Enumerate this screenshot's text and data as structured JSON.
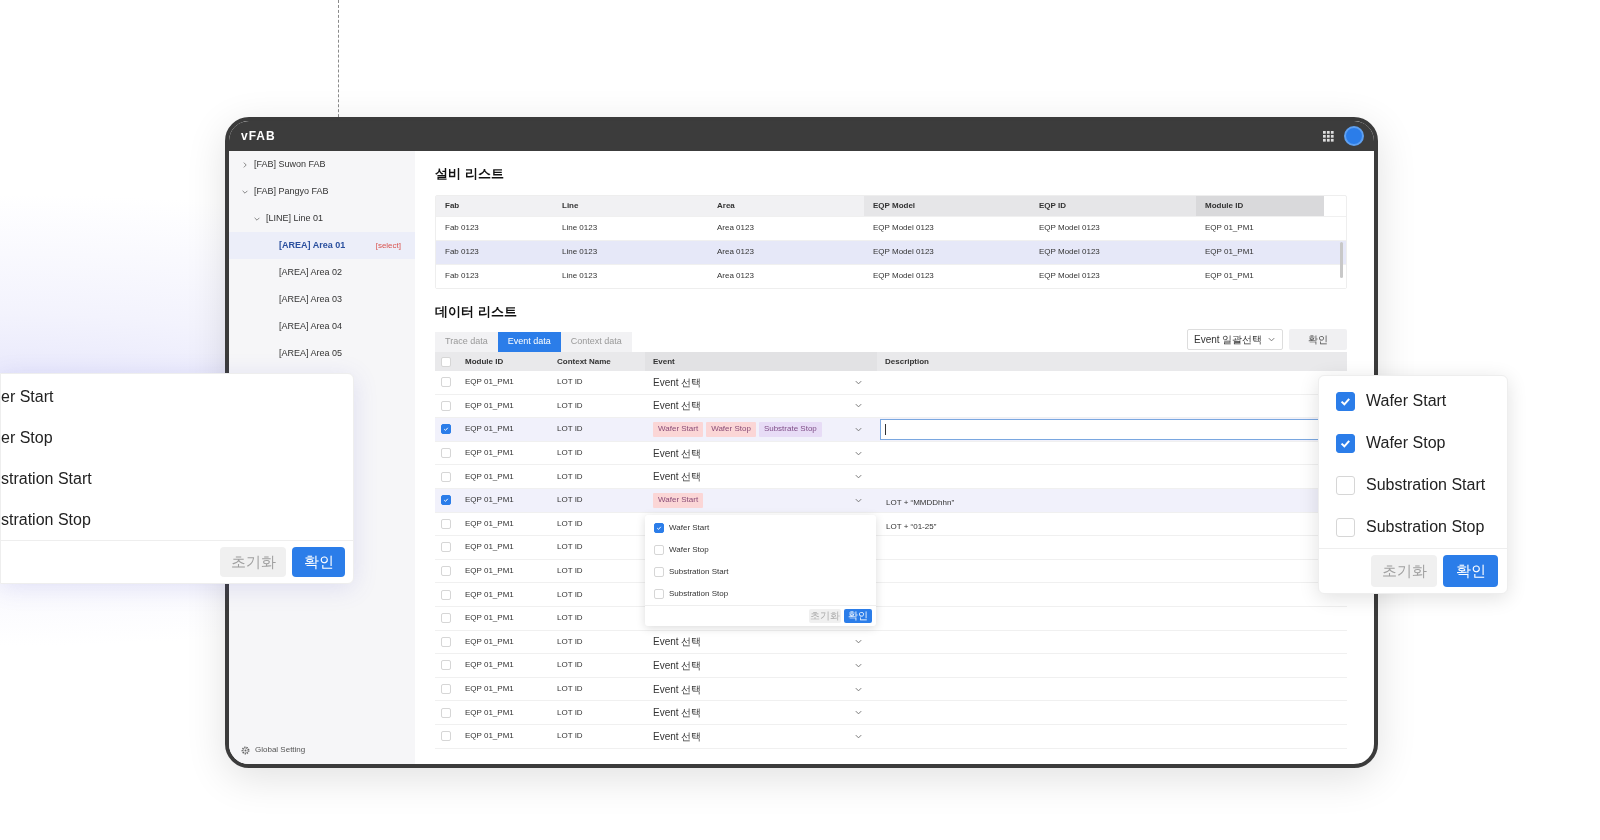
{
  "app": {
    "logo": "vFAB"
  },
  "sidebar": {
    "tree": [
      {
        "label": "[FAB] Suwon FAB",
        "expanded": false,
        "selected": false
      },
      {
        "label": "[FAB] Pangyo FAB",
        "expanded": true,
        "selected": false,
        "children": [
          {
            "label": "[LINE] Line 01",
            "expanded": true,
            "selected": false,
            "children": [
              {
                "label": "[AREA] Area 01",
                "selected": true,
                "badge": "[select]"
              },
              {
                "label": "[AREA] Area 02",
                "selected": false
              },
              {
                "label": "[AREA] Area 03",
                "selected": false
              },
              {
                "label": "[AREA] Area 04",
                "selected": false
              },
              {
                "label": "[AREA] Area 05",
                "selected": false
              }
            ]
          }
        ]
      }
    ],
    "footer": "Global Setting"
  },
  "equipment": {
    "title": "설비 리스트",
    "columns": [
      "Fab",
      "Line",
      "Area",
      "EQP Model",
      "EQP ID",
      "Module ID"
    ],
    "rows": [
      {
        "selected": false,
        "cells": [
          "Fab 0123",
          "Line 0123",
          "Area 0123",
          "EQP Model 0123",
          "EQP Model 0123",
          "EQP 01_PM1"
        ]
      },
      {
        "selected": true,
        "cells": [
          "Fab 0123",
          "Line 0123",
          "Area 0123",
          "EQP Model 0123",
          "EQP Model 0123",
          "EQP 01_PM1"
        ]
      },
      {
        "selected": false,
        "cells": [
          "Fab 0123",
          "Line 0123",
          "Area 0123",
          "EQP Model 0123",
          "EQP Model 0123",
          "EQP 01_PM1"
        ]
      }
    ]
  },
  "data": {
    "title": "데이터 리스트",
    "tabs": [
      {
        "label": "Trace data",
        "selected": false
      },
      {
        "label": "Event data",
        "selected": true
      },
      {
        "label": "Context data",
        "selected": false
      }
    ],
    "bulk_select": "Event 일괄선택",
    "confirm": "확인",
    "header_checked": false,
    "columns": [
      "Module ID",
      "Context Name",
      "Event",
      "Description"
    ],
    "rows": [
      {
        "checked": false,
        "module": "EQP 01_PM1",
        "context": "LOT ID",
        "event": "Event 선택"
      },
      {
        "checked": false,
        "module": "EQP 01_PM1",
        "context": "LOT ID",
        "event": "Event 선택"
      },
      {
        "checked": true,
        "module": "EQP 01_PM1",
        "context": "LOT ID",
        "tags": [
          {
            "label": "Wafer Start",
            "color": "#fbd6d6"
          },
          {
            "label": "Wafer Stop",
            "color": "#fbd6d6"
          },
          {
            "label": "Substrate Stop",
            "color": "#e7dcf6"
          }
        ],
        "editing": true
      },
      {
        "checked": false,
        "module": "EQP 01_PM1",
        "context": "LOT ID",
        "event": "Event 선택"
      },
      {
        "checked": false,
        "module": "EQP 01_PM1",
        "context": "LOT ID",
        "event": "Event 선택"
      },
      {
        "checked": true,
        "module": "EQP 01_PM1",
        "context": "LOT ID",
        "tags": [
          {
            "label": "Wafer Start",
            "color": "#fbd6d6"
          }
        ],
        "description": "LOT + “MMDDhhn”"
      },
      {
        "checked": false,
        "module": "EQP 01_PM1",
        "context": "LOT ID",
        "description": "LOT + “01-25”"
      },
      {
        "checked": false,
        "module": "EQP 01_PM1",
        "context": "LOT ID"
      },
      {
        "checked": false,
        "module": "EQP 01_PM1",
        "context": "LOT ID"
      },
      {
        "checked": false,
        "module": "EQP 01_PM1",
        "context": "LOT ID"
      },
      {
        "checked": false,
        "module": "EQP 01_PM1",
        "context": "LOT ID"
      },
      {
        "checked": false,
        "module": "EQP 01_PM1",
        "context": "LOT ID",
        "event": "Event 선택"
      },
      {
        "checked": false,
        "module": "EQP 01_PM1",
        "context": "LOT ID",
        "event": "Event 선택"
      },
      {
        "checked": false,
        "module": "EQP 01_PM1",
        "context": "LOT ID",
        "event": "Event 선택"
      },
      {
        "checked": false,
        "module": "EQP 01_PM1",
        "context": "LOT ID",
        "event": "Event 선택"
      },
      {
        "checked": false,
        "module": "EQP 01_PM1",
        "context": "LOT ID",
        "event": "Event 선택"
      }
    ],
    "popup": {
      "options": [
        {
          "label": "Wafer Start",
          "checked": true
        },
        {
          "label": "Wafer Stop",
          "checked": false
        },
        {
          "label": "Substration Start",
          "checked": false
        },
        {
          "label": "Substration Stop",
          "checked": false
        }
      ],
      "reset": "초기화",
      "confirm": "확인"
    }
  },
  "callout_left": {
    "options": [
      "er Start",
      "er Stop",
      "stration Start",
      "stration Stop"
    ],
    "reset": "초기화",
    "confirm": "확인"
  },
  "callout_right": {
    "options": [
      {
        "label": "Wafer Start",
        "checked": true
      },
      {
        "label": "Wafer Stop",
        "checked": true
      },
      {
        "label": "Substration Start",
        "checked": false
      },
      {
        "label": "Substration Stop",
        "checked": false
      }
    ],
    "reset": "초기화",
    "confirm": "확인"
  }
}
